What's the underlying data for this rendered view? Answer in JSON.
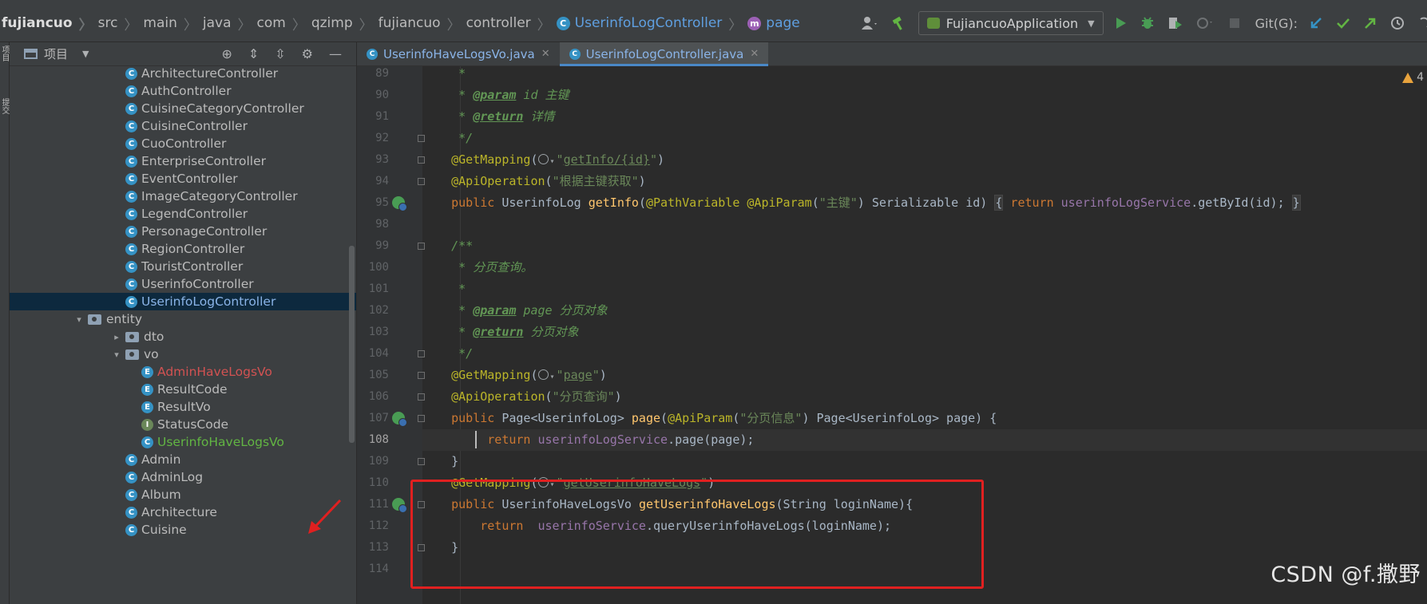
{
  "breadcrumb": {
    "items": [
      "fujiancuo",
      "src",
      "main",
      "java",
      "com",
      "qzimp",
      "fujiancuo",
      "controller",
      "UserinfoLogController",
      "page"
    ]
  },
  "toolbar": {
    "run_config": "FujiancuoApplication",
    "git_label": "Git(G):",
    "icons": [
      "user-icon",
      "hammer-icon",
      "run-icon",
      "debug-icon",
      "coverage-icon",
      "profile-icon",
      "stop-icon",
      "git-update-icon",
      "git-commit-icon",
      "git-push-icon",
      "history-icon"
    ]
  },
  "left_strip": {
    "top_label": "项目",
    "second_label": "提交"
  },
  "project": {
    "title": "项目",
    "tree": [
      {
        "label": "ArchitectureController",
        "icon": "class",
        "level": 2,
        "color": "normal"
      },
      {
        "label": "AuthController",
        "icon": "class",
        "level": 2,
        "color": "normal"
      },
      {
        "label": "CuisineCategoryController",
        "icon": "class",
        "level": 2,
        "color": "normal"
      },
      {
        "label": "CuisineController",
        "icon": "class",
        "level": 2,
        "color": "normal"
      },
      {
        "label": "CuoController",
        "icon": "class",
        "level": 2,
        "color": "normal"
      },
      {
        "label": "EnterpriseController",
        "icon": "class",
        "level": 2,
        "color": "normal"
      },
      {
        "label": "EventController",
        "icon": "class",
        "level": 2,
        "color": "normal"
      },
      {
        "label": "ImageCategoryController",
        "icon": "class",
        "level": 2,
        "color": "normal"
      },
      {
        "label": "LegendController",
        "icon": "class",
        "level": 2,
        "color": "normal"
      },
      {
        "label": "PersonageController",
        "icon": "class",
        "level": 2,
        "color": "normal"
      },
      {
        "label": "RegionController",
        "icon": "class",
        "level": 2,
        "color": "normal"
      },
      {
        "label": "TouristController",
        "icon": "class",
        "level": 2,
        "color": "normal"
      },
      {
        "label": "UserinfoController",
        "icon": "class",
        "level": 2,
        "color": "normal"
      },
      {
        "label": "UserinfoLogController",
        "icon": "class",
        "level": 2,
        "color": "blue",
        "selected": true
      },
      {
        "label": "entity",
        "icon": "folder",
        "level": 1,
        "arrow": "down",
        "color": "normal"
      },
      {
        "label": "dto",
        "icon": "folder",
        "level": 2,
        "arrow": "right",
        "color": "normal"
      },
      {
        "label": "vo",
        "icon": "folder",
        "level": 2,
        "arrow": "down",
        "color": "normal"
      },
      {
        "label": "AdminHaveLogsVo",
        "icon": "enum",
        "level": 3,
        "color": "red"
      },
      {
        "label": "ResultCode",
        "icon": "enum",
        "level": 3,
        "color": "normal"
      },
      {
        "label": "ResultVo",
        "icon": "enum",
        "level": 3,
        "color": "normal"
      },
      {
        "label": "StatusCode",
        "icon": "interface",
        "level": 3,
        "color": "normal"
      },
      {
        "label": "UserinfoHaveLogsVo",
        "icon": "class",
        "level": 3,
        "color": "green"
      },
      {
        "label": "Admin",
        "icon": "class",
        "level": 2,
        "color": "normal"
      },
      {
        "label": "AdminLog",
        "icon": "class",
        "level": 2,
        "color": "normal"
      },
      {
        "label": "Album",
        "icon": "class",
        "level": 2,
        "color": "normal"
      },
      {
        "label": "Architecture",
        "icon": "class",
        "level": 2,
        "color": "normal"
      },
      {
        "label": "Cuisine",
        "icon": "class",
        "level": 2,
        "color": "normal"
      }
    ]
  },
  "editor": {
    "tabs": [
      {
        "label": "UserinfoHaveLogsVo.java",
        "active": false
      },
      {
        "label": "UserinfoLogController.java",
        "active": true
      }
    ],
    "warning_count": "4",
    "current_line": 108,
    "lines": [
      {
        "num": 89,
        "segments": [
          {
            "c": "doc",
            "t": "     *"
          }
        ]
      },
      {
        "num": 90,
        "segments": [
          {
            "c": "doc",
            "t": "     * "
          },
          {
            "c": "tag",
            "t": "@param"
          },
          {
            "c": "doc",
            "t": " id 主键"
          }
        ]
      },
      {
        "num": 91,
        "segments": [
          {
            "c": "doc",
            "t": "     * "
          },
          {
            "c": "tag",
            "t": "@return"
          },
          {
            "c": "doc",
            "t": " 详情"
          }
        ]
      },
      {
        "num": 92,
        "fold": true,
        "segments": [
          {
            "c": "doc",
            "t": "     */"
          }
        ]
      },
      {
        "num": 93,
        "fold": true,
        "segments": [
          {
            "c": "ann",
            "t": "    @GetMapping"
          },
          {
            "c": "plain",
            "t": "("
          },
          {
            "c": "globe",
            "t": ""
          },
          {
            "c": "str",
            "t": "\""
          },
          {
            "c": "stru",
            "t": "getInfo/{id}"
          },
          {
            "c": "str",
            "t": "\""
          },
          {
            "c": "plain",
            "t": ")"
          }
        ]
      },
      {
        "num": 94,
        "fold": true,
        "segments": [
          {
            "c": "ann",
            "t": "    @ApiOperation"
          },
          {
            "c": "plain",
            "t": "("
          },
          {
            "c": "str",
            "t": "\"根据主键获取\""
          },
          {
            "c": "plain",
            "t": ")"
          }
        ]
      },
      {
        "num": 95,
        "run": true,
        "segments": [
          {
            "c": "kw",
            "t": "    public "
          },
          {
            "c": "plain",
            "t": "UserinfoLog "
          },
          {
            "c": "fn",
            "t": "getInfo"
          },
          {
            "c": "plain",
            "t": "("
          },
          {
            "c": "ann",
            "t": "@PathVariable @ApiParam"
          },
          {
            "c": "plain",
            "t": "("
          },
          {
            "c": "str",
            "t": "\"主键\""
          },
          {
            "c": "plain",
            "t": ") Serializable id) "
          },
          {
            "c": "brace",
            "t": "{"
          },
          {
            "c": "kw",
            "t": " return "
          },
          {
            "c": "field",
            "t": "userinfoLogService"
          },
          {
            "c": "plain",
            "t": ".getById(id); "
          },
          {
            "c": "brace",
            "t": "}"
          }
        ]
      },
      {
        "num": 98,
        "segments": [
          {
            "c": "plain",
            "t": ""
          }
        ]
      },
      {
        "num": 99,
        "fold": true,
        "segments": [
          {
            "c": "doc",
            "t": "    /**"
          }
        ]
      },
      {
        "num": 100,
        "segments": [
          {
            "c": "doc",
            "t": "     * 分页查询。"
          }
        ]
      },
      {
        "num": 101,
        "segments": [
          {
            "c": "doc",
            "t": "     *"
          }
        ]
      },
      {
        "num": 102,
        "segments": [
          {
            "c": "doc",
            "t": "     * "
          },
          {
            "c": "tag",
            "t": "@param"
          },
          {
            "c": "doc",
            "t": " page 分页对象"
          }
        ]
      },
      {
        "num": 103,
        "segments": [
          {
            "c": "doc",
            "t": "     * "
          },
          {
            "c": "tag",
            "t": "@return"
          },
          {
            "c": "doc",
            "t": " 分页对象"
          }
        ]
      },
      {
        "num": 104,
        "fold": true,
        "segments": [
          {
            "c": "doc",
            "t": "     */"
          }
        ]
      },
      {
        "num": 105,
        "fold": true,
        "segments": [
          {
            "c": "ann",
            "t": "    @GetMapping"
          },
          {
            "c": "plain",
            "t": "("
          },
          {
            "c": "globe",
            "t": ""
          },
          {
            "c": "str",
            "t": "\""
          },
          {
            "c": "stru",
            "t": "page"
          },
          {
            "c": "str",
            "t": "\""
          },
          {
            "c": "plain",
            "t": ")"
          }
        ]
      },
      {
        "num": 106,
        "fold": true,
        "segments": [
          {
            "c": "ann",
            "t": "    @ApiOperation"
          },
          {
            "c": "plain",
            "t": "("
          },
          {
            "c": "str",
            "t": "\"分页查询\""
          },
          {
            "c": "plain",
            "t": ")"
          }
        ]
      },
      {
        "num": 107,
        "run": true,
        "fold": true,
        "segments": [
          {
            "c": "kw",
            "t": "    public "
          },
          {
            "c": "plain",
            "t": "Page<UserinfoLog> "
          },
          {
            "c": "fn",
            "t": "page"
          },
          {
            "c": "plain",
            "t": "("
          },
          {
            "c": "ann",
            "t": "@ApiParam"
          },
          {
            "c": "plain",
            "t": "("
          },
          {
            "c": "str",
            "t": "\"分页信息\""
          },
          {
            "c": "plain",
            "t": ") Page<UserinfoLog> page) {"
          }
        ]
      },
      {
        "num": 108,
        "segments": [
          {
            "c": "kw",
            "t": "         return "
          },
          {
            "c": "field",
            "t": "userinfoLogService"
          },
          {
            "c": "plain",
            "t": ".page(page);"
          }
        ]
      },
      {
        "num": 109,
        "fold": true,
        "segments": [
          {
            "c": "plain",
            "t": "    }"
          }
        ]
      },
      {
        "num": 110,
        "segments": [
          {
            "c": "ann",
            "t": "    @GetMapping"
          },
          {
            "c": "plain",
            "t": "("
          },
          {
            "c": "globe",
            "t": ""
          },
          {
            "c": "str",
            "t": "\""
          },
          {
            "c": "stru",
            "t": "getUserinfoHaveLogs"
          },
          {
            "c": "str",
            "t": "\""
          },
          {
            "c": "plain",
            "t": ")"
          }
        ]
      },
      {
        "num": 111,
        "run": true,
        "fold": true,
        "segments": [
          {
            "c": "kw",
            "t": "    public "
          },
          {
            "c": "plain",
            "t": "UserinfoHaveLogsVo "
          },
          {
            "c": "fn",
            "t": "getUserinfoHaveLogs"
          },
          {
            "c": "plain",
            "t": "(String loginName){"
          }
        ]
      },
      {
        "num": 112,
        "segments": [
          {
            "c": "kw",
            "t": "        return  "
          },
          {
            "c": "field",
            "t": "userinfoService"
          },
          {
            "c": "plain",
            "t": ".queryUserinfoHaveLogs(loginName);"
          }
        ]
      },
      {
        "num": 113,
        "fold": true,
        "segments": [
          {
            "c": "plain",
            "t": "    }"
          }
        ]
      },
      {
        "num": 114,
        "segments": [
          {
            "c": "plain",
            "t": ""
          }
        ]
      }
    ]
  },
  "watermark": "CSDN @f.撒野",
  "colors": {
    "highlight_box": "#e02020",
    "selection": "#0d293e",
    "accent": "#4a88c7"
  }
}
